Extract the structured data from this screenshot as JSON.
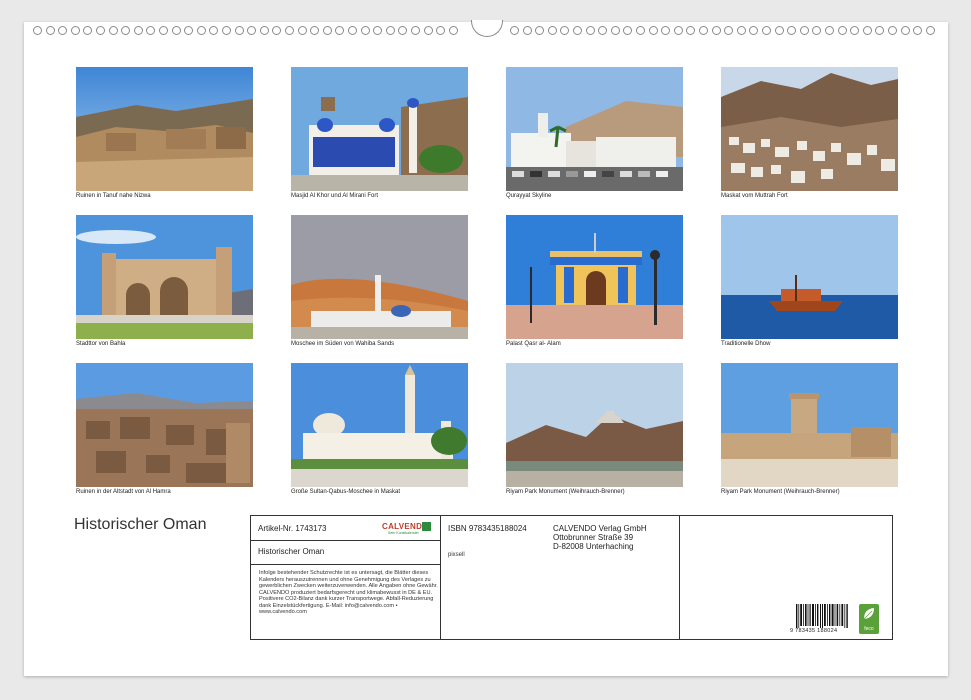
{
  "tiles": [
    {
      "caption": "Ruinen in Tanuf nahe Nizwa"
    },
    {
      "caption": "Masjid Al Khor und Al Mirani Fort"
    },
    {
      "caption": "Qurayyat Skyline"
    },
    {
      "caption": "Maskat vom Muttrah Fort"
    },
    {
      "caption": "Stadttor von Bahla"
    },
    {
      "caption": "Moschee im Süden von Wahiba Sands"
    },
    {
      "caption": "Palast Qasr al- Alam"
    },
    {
      "caption": "Traditionelle Dhow"
    },
    {
      "caption": "Ruinen in der Altstadt von Al Hamra"
    },
    {
      "caption": "Große Sultan-Qabus-Moschee in Maskat"
    },
    {
      "caption": "Riyam Park Monument (Weihrauch-Brenner)"
    },
    {
      "caption": "Riyam Park Monument (Weihrauch-Brenner)"
    }
  ],
  "calendar_title": "Historischer Oman",
  "info": {
    "article": "Artikel-Nr. 1743173",
    "publisher_logo": "CALVENDO",
    "publisher_logo_sub": "Sehr Kunstkalender",
    "title": "Historischer Oman",
    "isbn": "ISBN 9783435188024",
    "sub_code": "pixsell",
    "address_1": "CALVENDO Verlag GmbH",
    "address_2": "Ottobrunner Straße 39",
    "address_3": "D-82008 Unterhaching",
    "legal": "Infolge bestehender Schutzrechte ist es untersagt, die Blätter dieses Kalenders herauszutrennen und ohne Genehmigung des Verlages zu gewerblichen Zwecken weiterzuverwenden. Alle Angaben ohne Gewähr. CALVENDO produziert bedarfsgerecht und klimabewusst in DE & EU. Positivere CO2-Bilanz dank kurzer Transportwege. Abfall-Reduzierung dank Einzelstückfertigung. E-Mail: info@calvendo.com • www.calvendo.com",
    "barcode_number": "9 783435 188024",
    "eco_label": "feco"
  }
}
